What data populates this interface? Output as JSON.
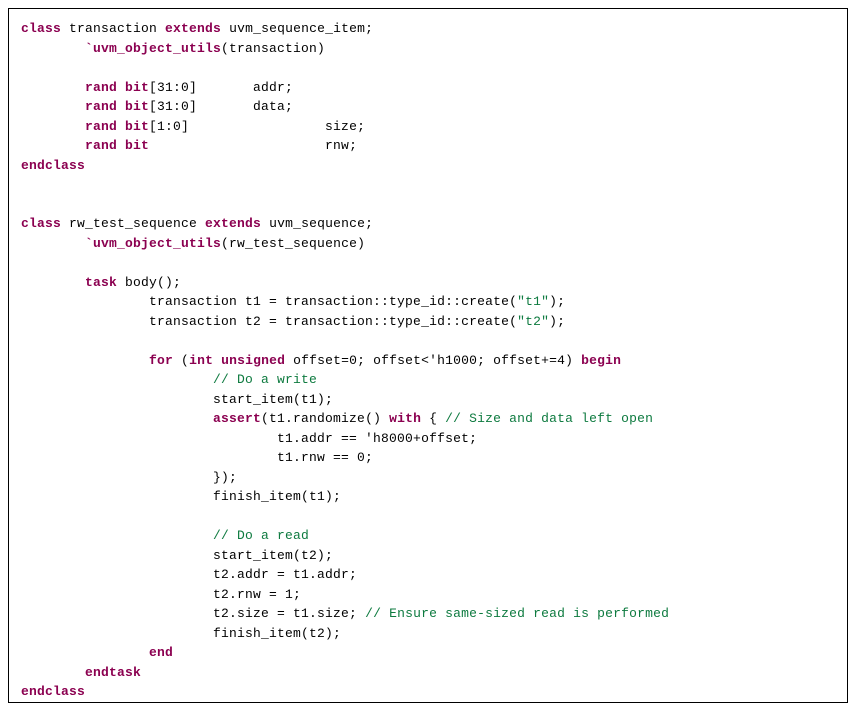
{
  "code": {
    "lines": [
      {
        "segments": [
          {
            "t": "class",
            "c": "kw"
          },
          {
            "t": " transaction "
          },
          {
            "t": "extends",
            "c": "kw"
          },
          {
            "t": " uvm_sequence_item;"
          }
        ]
      },
      {
        "segments": [
          {
            "t": "        "
          },
          {
            "t": "`uvm_object_utils",
            "c": "kw"
          },
          {
            "t": "(transaction)"
          }
        ]
      },
      {
        "segments": [
          {
            "t": ""
          }
        ]
      },
      {
        "segments": [
          {
            "t": "        "
          },
          {
            "t": "rand bit",
            "c": "kw"
          },
          {
            "t": "[31:0]       addr;"
          }
        ]
      },
      {
        "segments": [
          {
            "t": "        "
          },
          {
            "t": "rand bit",
            "c": "kw"
          },
          {
            "t": "[31:0]       data;"
          }
        ]
      },
      {
        "segments": [
          {
            "t": "        "
          },
          {
            "t": "rand bit",
            "c": "kw"
          },
          {
            "t": "[1:0]                 size;"
          }
        ]
      },
      {
        "segments": [
          {
            "t": "        "
          },
          {
            "t": "rand bit",
            "c": "kw"
          },
          {
            "t": "                      rnw;"
          }
        ]
      },
      {
        "segments": [
          {
            "t": "endclass",
            "c": "kw"
          }
        ]
      },
      {
        "segments": [
          {
            "t": ""
          }
        ]
      },
      {
        "segments": [
          {
            "t": ""
          }
        ]
      },
      {
        "segments": [
          {
            "t": "class",
            "c": "kw"
          },
          {
            "t": " rw_test_sequence "
          },
          {
            "t": "extends",
            "c": "kw"
          },
          {
            "t": " uvm_sequence;"
          }
        ]
      },
      {
        "segments": [
          {
            "t": "        "
          },
          {
            "t": "`uvm_object_utils",
            "c": "kw"
          },
          {
            "t": "(rw_test_sequence)"
          }
        ]
      },
      {
        "segments": [
          {
            "t": ""
          }
        ]
      },
      {
        "segments": [
          {
            "t": "        "
          },
          {
            "t": "task",
            "c": "kw"
          },
          {
            "t": " body();"
          }
        ]
      },
      {
        "segments": [
          {
            "t": "                transaction t1 = transaction::type_id::create("
          },
          {
            "t": "\"t1\"",
            "c": "str"
          },
          {
            "t": ");"
          }
        ]
      },
      {
        "segments": [
          {
            "t": "                transaction t2 = transaction::type_id::create("
          },
          {
            "t": "\"t2\"",
            "c": "str"
          },
          {
            "t": ");"
          }
        ]
      },
      {
        "segments": [
          {
            "t": ""
          }
        ]
      },
      {
        "segments": [
          {
            "t": "                "
          },
          {
            "t": "for",
            "c": "kw"
          },
          {
            "t": " ("
          },
          {
            "t": "int unsigned",
            "c": "kw"
          },
          {
            "t": " offset=0; offset<'h1000; offset+=4) "
          },
          {
            "t": "begin",
            "c": "kw"
          }
        ]
      },
      {
        "segments": [
          {
            "t": "                        "
          },
          {
            "t": "// Do a write",
            "c": "comment"
          }
        ]
      },
      {
        "segments": [
          {
            "t": "                        start_item(t1);"
          }
        ]
      },
      {
        "segments": [
          {
            "t": "                        "
          },
          {
            "t": "assert",
            "c": "kw"
          },
          {
            "t": "(t1.randomize() "
          },
          {
            "t": "with",
            "c": "kw"
          },
          {
            "t": " { "
          },
          {
            "t": "// Size and data left open",
            "c": "comment"
          }
        ]
      },
      {
        "segments": [
          {
            "t": "                                t1.addr == 'h8000+offset;"
          }
        ]
      },
      {
        "segments": [
          {
            "t": "                                t1.rnw == 0;"
          }
        ]
      },
      {
        "segments": [
          {
            "t": "                        });"
          }
        ]
      },
      {
        "segments": [
          {
            "t": "                        finish_item(t1);"
          }
        ]
      },
      {
        "segments": [
          {
            "t": ""
          }
        ]
      },
      {
        "segments": [
          {
            "t": "                        "
          },
          {
            "t": "// Do a read",
            "c": "comment"
          }
        ]
      },
      {
        "segments": [
          {
            "t": "                        start_item(t2);"
          }
        ]
      },
      {
        "segments": [
          {
            "t": "                        t2.addr = t1.addr;"
          }
        ]
      },
      {
        "segments": [
          {
            "t": "                        t2.rnw = 1;"
          }
        ]
      },
      {
        "segments": [
          {
            "t": "                        t2.size = t1.size; "
          },
          {
            "t": "// Ensure same-sized read is performed",
            "c": "comment"
          }
        ]
      },
      {
        "segments": [
          {
            "t": "                        finish_item(t2);"
          }
        ]
      },
      {
        "segments": [
          {
            "t": "                "
          },
          {
            "t": "end",
            "c": "kw"
          }
        ]
      },
      {
        "segments": [
          {
            "t": "        "
          },
          {
            "t": "endtask",
            "c": "kw"
          }
        ]
      },
      {
        "segments": [
          {
            "t": "endclass",
            "c": "kw"
          }
        ]
      }
    ]
  }
}
